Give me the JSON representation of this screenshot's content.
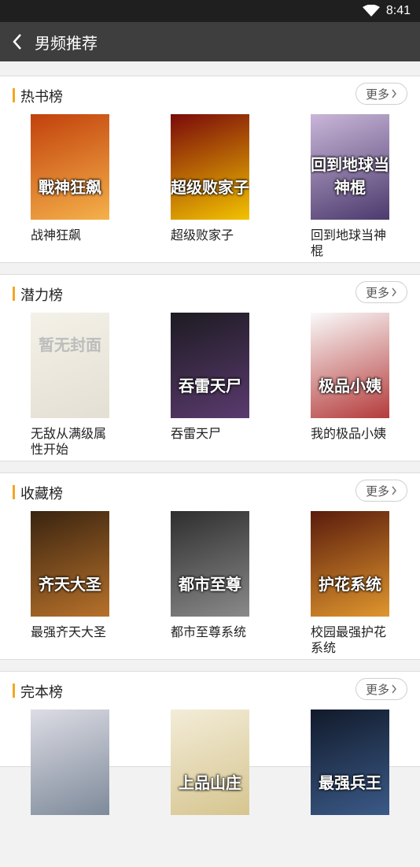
{
  "status": {
    "time": "8:41"
  },
  "header": {
    "title": "男频推荐"
  },
  "more_label": "更多",
  "sections": [
    {
      "title": "热书榜",
      "books": [
        {
          "title": "战神狂飙",
          "cover_text": "戰神狂飙",
          "c1": "#c2410c",
          "c2": "#f5b14a"
        },
        {
          "title": "超级败家子",
          "cover_text": "超级败家子",
          "c1": "#7a0a0a",
          "c2": "#f3c200"
        },
        {
          "title": "回到地球当神棍",
          "cover_text": "回到地球当神棍",
          "c1": "#c9b6d8",
          "c2": "#4c3a6e"
        }
      ]
    },
    {
      "title": "潜力榜",
      "books": [
        {
          "title": "无敌从满级属性开始",
          "cover_text": "暂无封面",
          "c1": "#f4f1e8",
          "c2": "#e3dfd3"
        },
        {
          "title": "吞雷天尸",
          "cover_text": "吞雷天尸",
          "c1": "#1d1b22",
          "c2": "#5a3a6e"
        },
        {
          "title": "我的极品小姨",
          "cover_text": "极品小姨",
          "c1": "#fafafa",
          "c2": "#b53b3b"
        }
      ]
    },
    {
      "title": "收藏榜",
      "books": [
        {
          "title": "最强齐天大圣",
          "cover_text": "齐天大圣",
          "c1": "#3a2410",
          "c2": "#b7712a"
        },
        {
          "title": "都市至尊系统",
          "cover_text": "都市至尊",
          "c1": "#2e2e2e",
          "c2": "#8a8a8a"
        },
        {
          "title": "校园最强护花系统",
          "cover_text": "护花系统",
          "c1": "#5a1c0c",
          "c2": "#e0962e"
        }
      ]
    },
    {
      "title": "完本榜",
      "books": [
        {
          "title": "",
          "cover_text": "",
          "c1": "#dcdce4",
          "c2": "#7e8a9a"
        },
        {
          "title": "",
          "cover_text": "上品山庄",
          "c1": "#f3ecd8",
          "c2": "#d6c58f"
        },
        {
          "title": "",
          "cover_text": "最强兵王",
          "c1": "#111a2a",
          "c2": "#3b5a88"
        }
      ]
    }
  ]
}
